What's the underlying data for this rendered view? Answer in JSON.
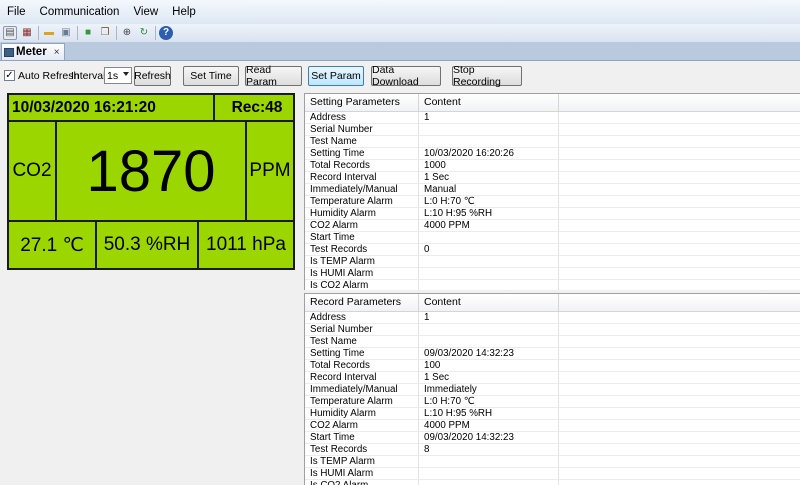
{
  "menu": [
    "File",
    "Communication",
    "View",
    "Help"
  ],
  "toolbar_icons": [
    "page-setup-icon",
    "print-icon",
    "open-folder-icon",
    "save-icon",
    "export-icon",
    "copy-icon",
    "connect-icon",
    "refresh-icon",
    "help-icon"
  ],
  "tab": {
    "label": "Meter",
    "close": "×"
  },
  "controls": {
    "auto_refresh_label": "Auto Refresh",
    "auto_refresh_checked": "✓",
    "interval_label": "Interval:",
    "interval_value": "1s",
    "refresh": "Refresh",
    "set_time": "Set Time",
    "read_param": "Read Param",
    "set_param": "Set Param",
    "data_download": "Data Download",
    "stop_recording": "Stop Recording"
  },
  "meter": {
    "datetime": "10/03/2020 16:21:20",
    "rec": "Rec:48",
    "gas": "CO2",
    "value": "1870",
    "unit": "PPM",
    "temp": "27.1 ℃",
    "humidity": "50.3 %RH",
    "pressure": "1011 hPa"
  },
  "setting_grid": {
    "headers": [
      "Setting Parameters",
      "Content"
    ],
    "rows": [
      [
        "Address",
        "1"
      ],
      [
        "Serial Number",
        ""
      ],
      [
        "Test Name",
        ""
      ],
      [
        "Setting Time",
        "10/03/2020 16:20:26"
      ],
      [
        "Total Records",
        "1000"
      ],
      [
        "Record Interval",
        "1 Sec"
      ],
      [
        "Immediately/Manual",
        "Manual"
      ],
      [
        "Temperature Alarm",
        "L:0 H:70 ℃"
      ],
      [
        "Humidity Alarm",
        "L:10 H:95 %RH"
      ],
      [
        "CO2 Alarm",
        "4000 PPM"
      ],
      [
        "Start Time",
        ""
      ],
      [
        "Test Records",
        "0"
      ],
      [
        "Is TEMP Alarm",
        ""
      ],
      [
        "Is HUMI Alarm",
        ""
      ],
      [
        "Is CO2 Alarm",
        ""
      ]
    ]
  },
  "record_grid": {
    "headers": [
      "Record Parameters",
      "Content"
    ],
    "rows": [
      [
        "Address",
        "1"
      ],
      [
        "Serial Number",
        ""
      ],
      [
        "Test Name",
        ""
      ],
      [
        "Setting Time",
        "09/03/2020 14:32:23"
      ],
      [
        "Total Records",
        "100"
      ],
      [
        "Record Interval",
        "1 Sec"
      ],
      [
        "Immediately/Manual",
        "Immediately"
      ],
      [
        "Temperature Alarm",
        "L:0 H:70 ℃"
      ],
      [
        "Humidity Alarm",
        "L:10 H:95 %RH"
      ],
      [
        "CO2 Alarm",
        "4000 PPM"
      ],
      [
        "Start Time",
        "09/03/2020 14:32:23"
      ],
      [
        "Test Records",
        "8"
      ],
      [
        "Is TEMP Alarm",
        ""
      ],
      [
        "Is HUMI Alarm",
        ""
      ],
      [
        "Is CO2 Alarm",
        ""
      ]
    ]
  },
  "colors": {
    "lcd_background": "#9bd600",
    "lcd_text": "#111111",
    "window_bg": "#f0f0f0"
  }
}
